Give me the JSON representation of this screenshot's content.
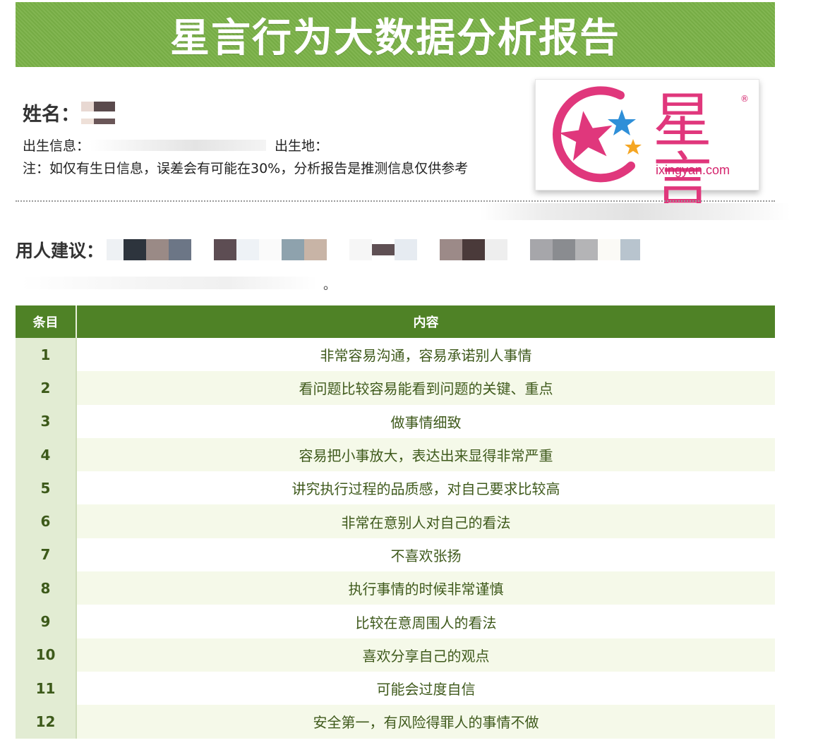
{
  "title": "星言行为大数据分析报告",
  "header": {
    "name_label": "姓名：",
    "birth_label": "出生信息：",
    "birth_place_label": "出生地：",
    "note": "注：如仅有生日信息，误差会有可能在30%，分析报告是推测信息仅供参考"
  },
  "logo": {
    "brand_cn": "星言",
    "domain": "ixingyan.com",
    "registered_mark": "®"
  },
  "advice": {
    "label": "用人建议：",
    "trailing_mark": "。"
  },
  "table": {
    "headers": [
      "条目",
      "内容"
    ],
    "rows": [
      {
        "index": "1",
        "content": "非常容易沟通，容易承诺别人事情"
      },
      {
        "index": "2",
        "content": "看问题比较容易能看到问题的关键、重点"
      },
      {
        "index": "3",
        "content": "做事情细致"
      },
      {
        "index": "4",
        "content": "容易把小事放大，表达出来显得非常严重"
      },
      {
        "index": "5",
        "content": "讲究执行过程的品质感，对自己要求比较高"
      },
      {
        "index": "6",
        "content": "非常在意别人对自己的看法"
      },
      {
        "index": "7",
        "content": "不喜欢张扬"
      },
      {
        "index": "8",
        "content": "执行事情的时候非常谨慎"
      },
      {
        "index": "9",
        "content": "比较在意周围人的看法"
      },
      {
        "index": "10",
        "content": "喜欢分享自己的观点"
      },
      {
        "index": "11",
        "content": "可能会过度自信"
      },
      {
        "index": "12",
        "content": "安全第一，有风险得罪人的事情不做"
      }
    ]
  },
  "colors": {
    "banner": "#7ab147",
    "table_header": "#4f8226",
    "index_cell": "#e2ecd3",
    "alt_row": "#f5f9e9",
    "logo_pink": "#e0377c",
    "logo_blue": "#2f8fd8",
    "logo_orange": "#f5a623"
  }
}
